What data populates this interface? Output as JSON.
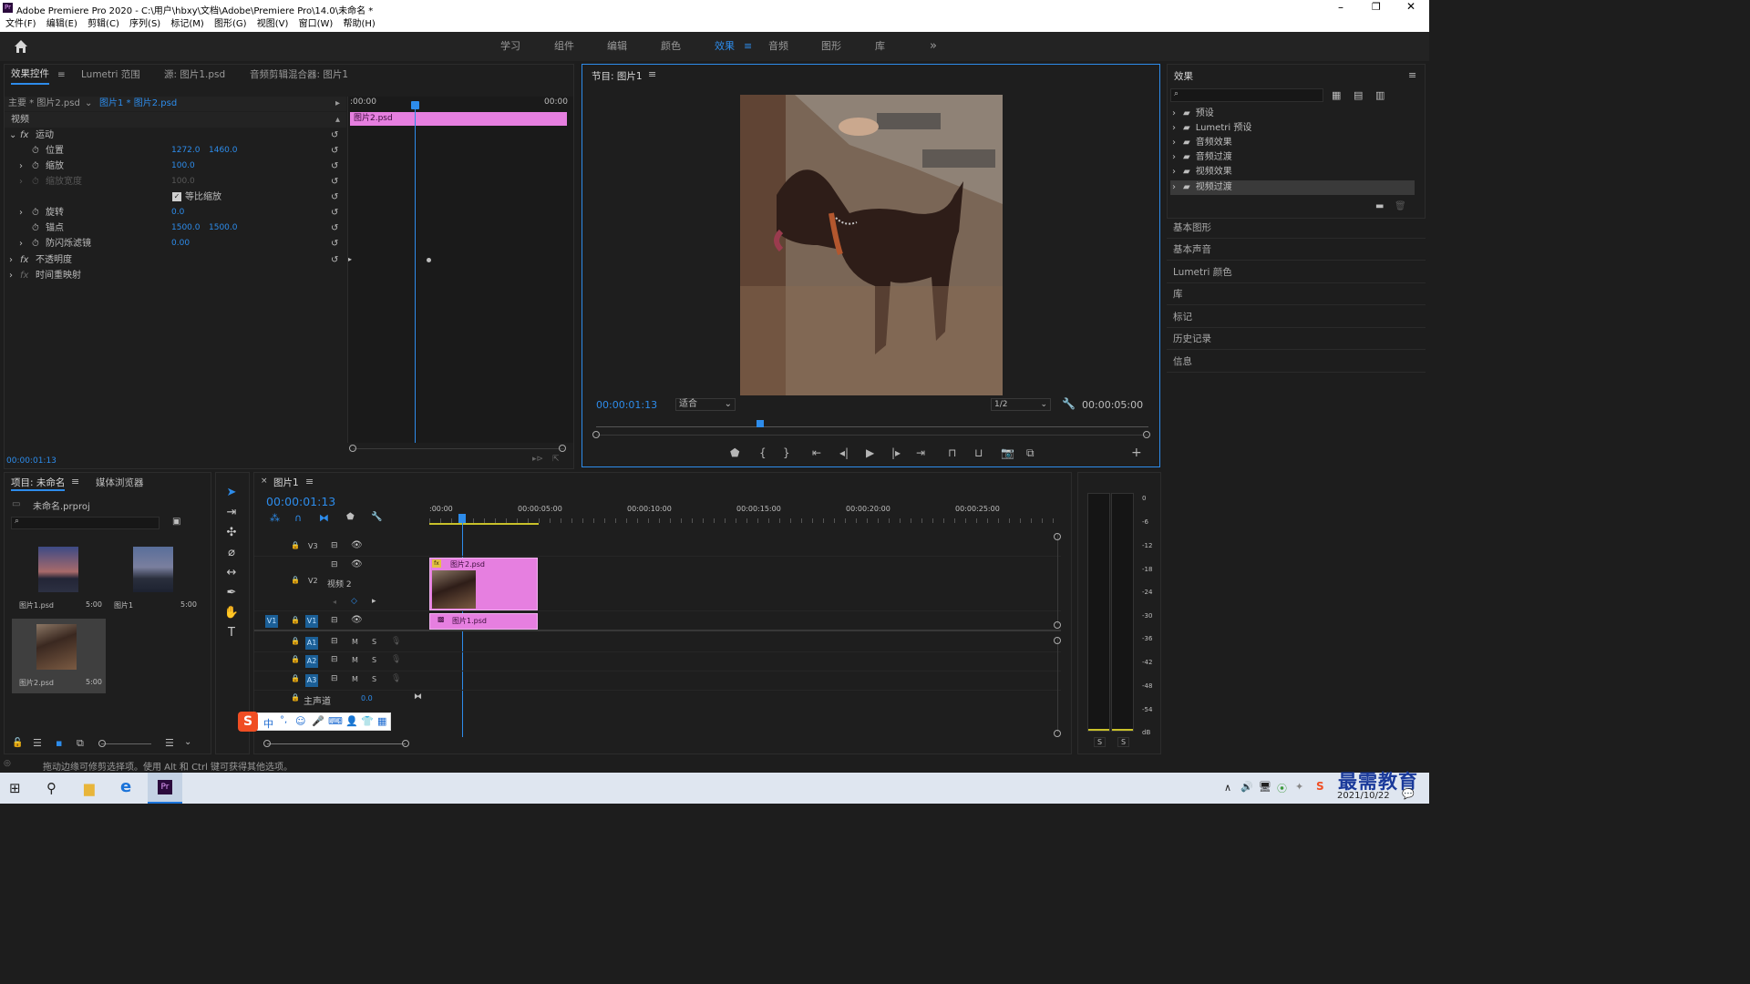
{
  "window": {
    "title": "Adobe Premiere Pro 2020 - C:\\用户\\hbxy\\文档\\Adobe\\Premiere Pro\\14.0\\未命名 *",
    "app_icon": "Pr"
  },
  "menu": [
    "文件(F)",
    "编辑(E)",
    "剪辑(C)",
    "序列(S)",
    "标记(M)",
    "图形(G)",
    "视图(V)",
    "窗口(W)",
    "帮助(H)"
  ],
  "workspaces": [
    "学习",
    "组件",
    "编辑",
    "颜色",
    "效果",
    "音频",
    "图形",
    "库"
  ],
  "active_workspace": "效果",
  "effect_controls": {
    "tabs": [
      "效果控件",
      "Lumetri 范围",
      "源: 图片1.psd",
      "音频剪辑混合器: 图片1"
    ],
    "master": "主要 * 图片2.psd",
    "sequence_clip": "图片1 * 图片2.psd",
    "section_video": "视频",
    "ruler_start": ":00:00",
    "ruler_end": "00:00",
    "clip_label": "图片2.psd",
    "rows": [
      {
        "label": "运动",
        "fx": true
      },
      {
        "label": "位置",
        "v1": "1272.0",
        "v2": "1460.0"
      },
      {
        "label": "缩放",
        "v1": "100.0"
      },
      {
        "label": "缩放宽度",
        "v1": "100.0",
        "disabled": true
      },
      {
        "label": "等比缩放",
        "checkbox": true
      },
      {
        "label": "旋转",
        "v1": "0.0"
      },
      {
        "label": "锚点",
        "v1": "1500.0",
        "v2": "1500.0"
      },
      {
        "label": "防闪烁滤镜",
        "v1": "0.00"
      },
      {
        "label": "不透明度",
        "fx": true
      },
      {
        "label": "时间重映射",
        "fx": true
      }
    ],
    "timecode": "00:00:01:13"
  },
  "program": {
    "title": "节目: 图片1",
    "timecode": "00:00:01:13",
    "fit": "适合",
    "resolution": "1/2",
    "duration": "00:00:05:00"
  },
  "effects_panel": {
    "title": "效果",
    "items": [
      "预设",
      "Lumetri 预设",
      "音频效果",
      "音频过渡",
      "视频效果",
      "视频过渡"
    ],
    "selected": "视频过渡",
    "sections": [
      "基本图形",
      "基本声音",
      "Lumetri 颜色",
      "库",
      "标记",
      "历史记录",
      "信息"
    ]
  },
  "project": {
    "tabs": [
      "项目: 未命名",
      "媒体浏览器"
    ],
    "file": "未命名.prproj",
    "items": [
      {
        "name": "图片1.psd",
        "dur": "5:00"
      },
      {
        "name": "图片1",
        "dur": "5:00"
      },
      {
        "name": "图片2.psd",
        "dur": "5:00"
      }
    ]
  },
  "timeline": {
    "tab": "图片1",
    "timecode": "00:00:01:13",
    "ruler": [
      ":00:00",
      "00:00:05:00",
      "00:00:10:00",
      "00:00:15:00",
      "00:00:20:00",
      "00:00:25:00"
    ],
    "tracks_video": [
      "V3",
      "V2",
      "V1"
    ],
    "v2_name": "视频 2",
    "tracks_audio": [
      "A1",
      "A2",
      "A3"
    ],
    "master": "主声道",
    "master_value": "0.0",
    "clip_v2": "图片2.psd",
    "clip_v1": "图片1.psd",
    "src_v1": "V1",
    "btn_m": "M",
    "btn_s": "S"
  },
  "meter": {
    "labels": [
      "0",
      "-6",
      "-12",
      "-18",
      "-24",
      "-30",
      "-36",
      "-42",
      "-48",
      "-54",
      "dB"
    ],
    "solo": [
      "S",
      "S"
    ]
  },
  "status_text": "拖动边缘可修剪选择项。使用 Alt 和 Ctrl 键可获得其他选项。",
  "taskbar": {
    "date": "2021/10/22",
    "ime_label": "中",
    "watermark": "最需教育"
  },
  "colors": {
    "accent": "#2d8ceb",
    "clip_pink": "#e67fe0",
    "track_blue": "#1b5f97"
  }
}
